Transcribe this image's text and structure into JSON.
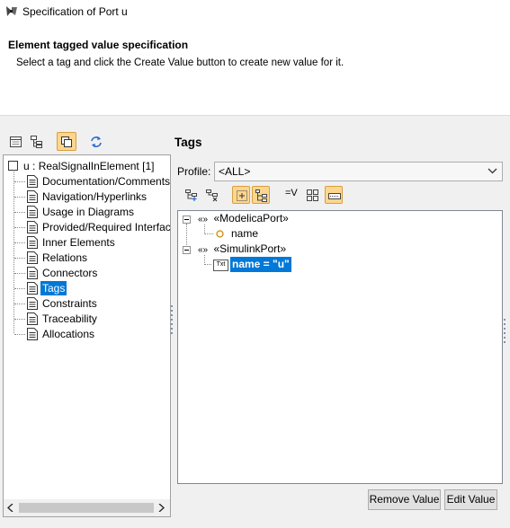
{
  "window": {
    "title": "Specification of Port u",
    "icon": "port-spec-icon"
  },
  "header": {
    "title": "Element tagged value specification",
    "description": "Select a tag and click the Create Value button to create new value for it."
  },
  "left_toolbar": {
    "buttons": [
      {
        "icon": "properties-list-icon",
        "active": false
      },
      {
        "icon": "tree-structure-icon",
        "active": false
      },
      {
        "icon": "copy-windows-icon",
        "active": true
      },
      {
        "icon": "refresh-icon",
        "active": false
      }
    ]
  },
  "left_tree": {
    "root": {
      "name": "u",
      "separator": " : ",
      "type": "RealSignalInElement [1]"
    },
    "items": [
      {
        "label": "Documentation/Comments"
      },
      {
        "label": "Navigation/Hyperlinks"
      },
      {
        "label": "Usage in Diagrams"
      },
      {
        "label": "Provided/Required Interfaces"
      },
      {
        "label": "Inner Elements"
      },
      {
        "label": "Relations"
      },
      {
        "label": "Connectors"
      },
      {
        "label": "Tags",
        "selected": true
      },
      {
        "label": "Constraints"
      },
      {
        "label": "Traceability"
      },
      {
        "label": "Allocations"
      }
    ]
  },
  "right_panel": {
    "title": "Tags",
    "profile_label": "Profile:",
    "profile_value": "<ALL>",
    "toolbar": {
      "buttons": [
        {
          "icon": "create-value-icon",
          "active": false
        },
        {
          "icon": "remove-value-icon",
          "active": false
        },
        {
          "icon": "expand-all-icon",
          "active": true
        },
        {
          "icon": "collapse-all-icon",
          "active": true
        },
        {
          "icon": "show-values-icon",
          "label": "=V",
          "active": false
        },
        {
          "icon": "grid-view-icon",
          "active": false
        },
        {
          "icon": "compact-view-icon",
          "active": true
        }
      ]
    },
    "tree": {
      "stereotype_icon": "«»",
      "groups": [
        {
          "label": "«ModelicaPort»",
          "children": [
            {
              "label": "name",
              "icon": "property-circle-icon"
            }
          ]
        },
        {
          "label": "«SimulinkPort»",
          "children": [
            {
              "label": "name = \"u\"",
              "icon": "text-value-icon",
              "icon_text": "Txt",
              "selected": true
            }
          ]
        }
      ]
    },
    "buttons": {
      "remove_value": "Remove Value",
      "edit_value": "Edit Value"
    }
  },
  "colors": {
    "selection": "#0078d7",
    "active_toggle": "#fcd68f",
    "panel_bg": "#f0f0f0"
  }
}
